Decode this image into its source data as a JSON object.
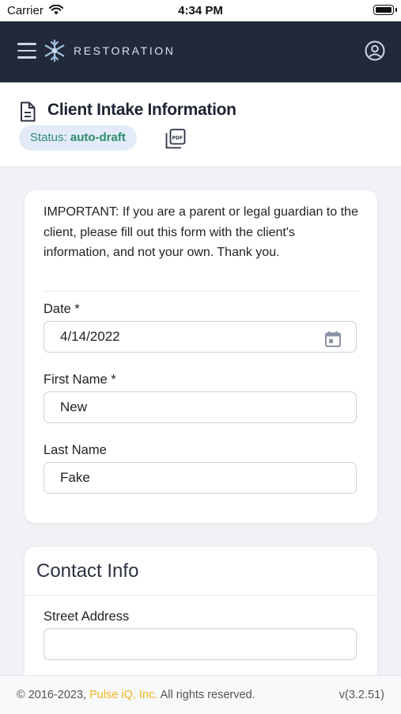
{
  "status_bar": {
    "carrier": "Carrier",
    "time": "4:34 PM"
  },
  "navbar": {
    "brand": "RESTORATION",
    "background": "#22293a"
  },
  "header": {
    "title": "Client Intake Information",
    "status_prefix": "Status: ",
    "status_value": "auto-draft"
  },
  "intake_card": {
    "notice": "IMPORTANT: If you are a parent or legal guardian to the client, please fill out this form with the client's information, and not your own. Thank you.",
    "date_label": "Date *",
    "date_value": "4/14/2022",
    "first_name_label": "First Name *",
    "first_name_value": "New",
    "last_name_label": "Last Name",
    "last_name_value": "Fake"
  },
  "contact_card": {
    "title": "Contact Info",
    "street_label": "Street Address",
    "street_value": ""
  },
  "footer": {
    "copyright": "© 2016-2023, ",
    "company": "Pulse iQ, Inc.",
    "rights": " All rights reserved.",
    "version": "v(3.2.51)"
  },
  "colors": {
    "accent_green": "#2b8c6b",
    "badge_bg": "#e3ebf8",
    "footer_brand": "#f2b41c"
  }
}
